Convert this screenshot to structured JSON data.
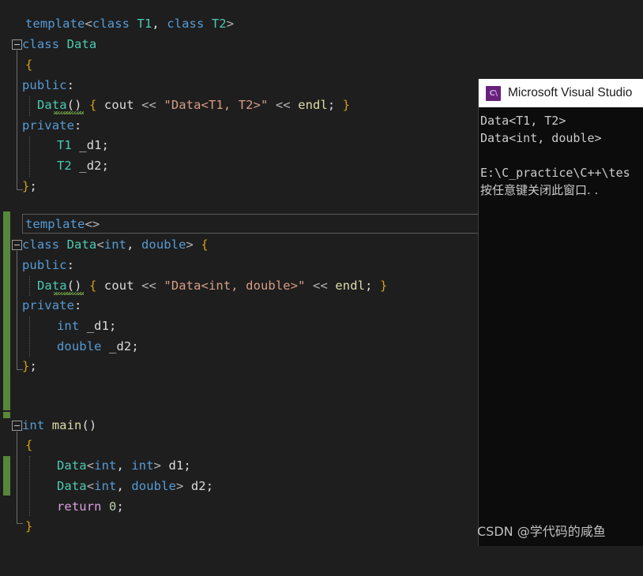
{
  "editor": {
    "background": "#1e1e1e",
    "change_bar_color": "#57873a",
    "blocks": [
      {
        "name": "primary-template",
        "lines": [
          "template<class T1, class T2>",
          "class Data",
          "{",
          "public:",
          "    Data() { cout << \"Data<T1, T2>\" << endl; }",
          "private:",
          "    T1 _d1;",
          "    T2 _d2;",
          "};"
        ]
      },
      {
        "name": "full-specialization",
        "lines": [
          "template<>",
          "class Data<int, double> {",
          "public:",
          "    Data() { cout << \"Data<int, double>\" << endl; }",
          "private:",
          "    int _d1;",
          "    double _d2;",
          "};"
        ]
      },
      {
        "name": "main-function",
        "lines": [
          "int main()",
          "{",
          "    Data<int, int> d1;",
          "    Data<int, double> d2;",
          "    return 0;",
          "}"
        ]
      }
    ],
    "current_line_text": "template<>",
    "squiggle_tooltip_target": "Data"
  },
  "console": {
    "title": "Microsoft Visual Studio",
    "icon": "visual-studio-cpp-icon",
    "icon_glyph": "C\\",
    "lines": [
      "Data<T1, T2>",
      "Data<int, double>",
      "",
      "E:\\C_practice\\C++\\tes",
      "按任意键关闭此窗口. ."
    ]
  },
  "watermark": {
    "text": "CSDN @学代码的咸鱼"
  },
  "code_tokens": {
    "b1_l1": [
      [
        "kw",
        "template"
      ],
      [
        "ang",
        "<"
      ],
      [
        "kw",
        "class"
      ],
      [
        "pln",
        " "
      ],
      [
        "typ",
        "T1"
      ],
      [
        "pun",
        ", "
      ],
      [
        "kw",
        "class"
      ],
      [
        "pln",
        " "
      ],
      [
        "typ",
        "T2"
      ],
      [
        "ang",
        ">"
      ]
    ],
    "b1_l2": [
      [
        "kw",
        "class"
      ],
      [
        "pln",
        " "
      ],
      [
        "typ",
        "Data"
      ]
    ],
    "b1_l3": [
      [
        "brc",
        "{"
      ]
    ],
    "b1_l4": [
      [
        "kw",
        "public"
      ],
      [
        "pun",
        ":"
      ]
    ],
    "b1_l5": [
      [
        "typ",
        "Data"
      ],
      [
        "pun",
        "() "
      ],
      [
        "brc",
        "{"
      ],
      [
        "pln",
        " "
      ],
      [
        "pln",
        "cout"
      ],
      [
        "pln",
        " "
      ],
      [
        "op",
        "<<"
      ],
      [
        "pln",
        " "
      ],
      [
        "str",
        "\"Data<T1, T2>\""
      ],
      [
        "pln",
        " "
      ],
      [
        "op",
        "<<"
      ],
      [
        "pln",
        " "
      ],
      [
        "fn",
        "endl"
      ],
      [
        "pun",
        "; "
      ],
      [
        "brc",
        "}"
      ]
    ],
    "b1_l6": [
      [
        "kw",
        "private"
      ],
      [
        "pun",
        ":"
      ]
    ],
    "b1_l7": [
      [
        "typ",
        "T1"
      ],
      [
        "pln",
        " _d1"
      ],
      [
        "pun",
        ";"
      ]
    ],
    "b1_l8": [
      [
        "typ",
        "T2"
      ],
      [
        "pln",
        " _d2"
      ],
      [
        "pun",
        ";"
      ]
    ],
    "b1_l9": [
      [
        "brc",
        "}"
      ],
      [
        "pun",
        ";"
      ]
    ],
    "b2_l1": [
      [
        "kw",
        "template"
      ],
      [
        "ang",
        "<>"
      ]
    ],
    "b2_l2": [
      [
        "kw",
        "class"
      ],
      [
        "pln",
        " "
      ],
      [
        "typ",
        "Data"
      ],
      [
        "ang",
        "<"
      ],
      [
        "kw",
        "int"
      ],
      [
        "pun",
        ", "
      ],
      [
        "kw",
        "double"
      ],
      [
        "ang",
        "> "
      ],
      [
        "brc",
        "{"
      ]
    ],
    "b2_l3": [
      [
        "kw",
        "public"
      ],
      [
        "pun",
        ":"
      ]
    ],
    "b2_l4": [
      [
        "typ",
        "Data"
      ],
      [
        "pun",
        "() "
      ],
      [
        "brc",
        "{"
      ],
      [
        "pln",
        " "
      ],
      [
        "pln",
        "cout"
      ],
      [
        "pln",
        " "
      ],
      [
        "op",
        "<<"
      ],
      [
        "pln",
        " "
      ],
      [
        "str",
        "\"Data<int, double>\""
      ],
      [
        "pln",
        " "
      ],
      [
        "op",
        "<<"
      ],
      [
        "pln",
        " "
      ],
      [
        "fn",
        "endl"
      ],
      [
        "pun",
        "; "
      ],
      [
        "brc",
        "}"
      ]
    ],
    "b2_l5": [
      [
        "kw",
        "private"
      ],
      [
        "pun",
        ":"
      ]
    ],
    "b2_l6": [
      [
        "kw",
        "int"
      ],
      [
        "pln",
        " _d1"
      ],
      [
        "pun",
        ";"
      ]
    ],
    "b2_l7": [
      [
        "kw",
        "double"
      ],
      [
        "pln",
        " _d2"
      ],
      [
        "pun",
        ";"
      ]
    ],
    "b2_l8": [
      [
        "brc",
        "}"
      ],
      [
        "pun",
        ";"
      ]
    ],
    "b3_l1": [
      [
        "kw",
        "int"
      ],
      [
        "pln",
        " "
      ],
      [
        "fn",
        "main"
      ],
      [
        "pun",
        "()"
      ]
    ],
    "b3_l2": [
      [
        "brc",
        "{"
      ]
    ],
    "b3_l3": [
      [
        "typ",
        "Data"
      ],
      [
        "ang",
        "<"
      ],
      [
        "kw",
        "int"
      ],
      [
        "pun",
        ", "
      ],
      [
        "kw",
        "int"
      ],
      [
        "ang",
        "> "
      ],
      [
        "pln",
        "d1"
      ],
      [
        "pun",
        ";"
      ]
    ],
    "b3_l4": [
      [
        "typ",
        "Data"
      ],
      [
        "ang",
        "<"
      ],
      [
        "kw",
        "int"
      ],
      [
        "pun",
        ", "
      ],
      [
        "kw",
        "double"
      ],
      [
        "ang",
        "> "
      ],
      [
        "pln",
        "d2"
      ],
      [
        "pun",
        ";"
      ]
    ],
    "b3_l5": [
      [
        "ctl",
        "return"
      ],
      [
        "pln",
        " "
      ],
      [
        "num",
        "0"
      ],
      [
        "pun",
        ";"
      ]
    ],
    "b3_l6": [
      [
        "brc",
        "}"
      ]
    ]
  }
}
